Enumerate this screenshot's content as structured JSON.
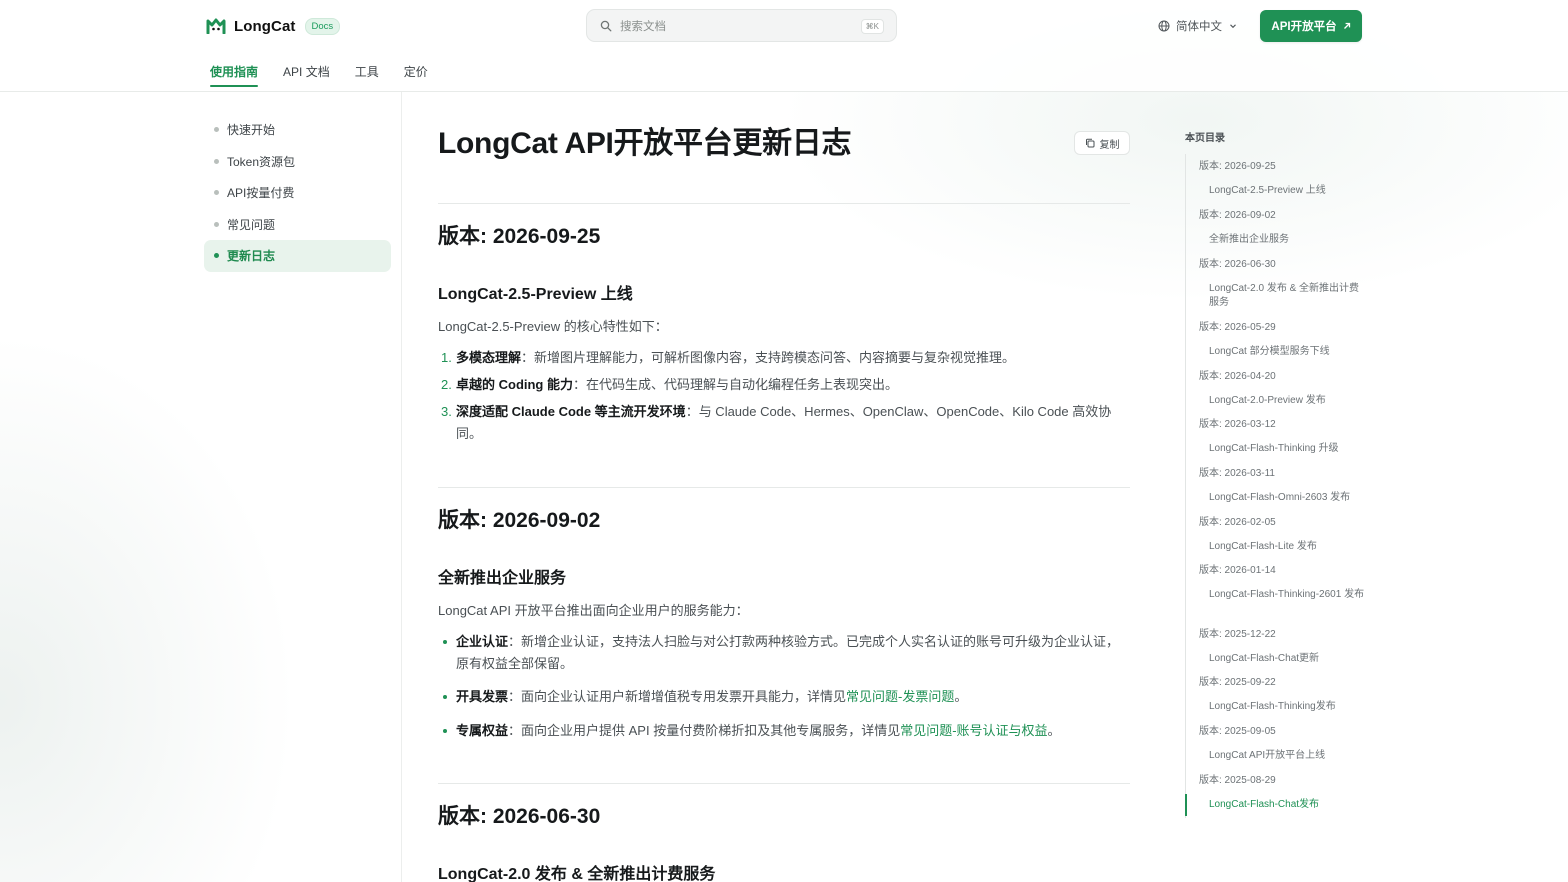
{
  "header": {
    "logo_text": "LongCat",
    "docs_badge": "Docs",
    "search_placeholder": "搜索文档",
    "search_shortcut": "⌘K",
    "language": "简体中文",
    "cta_label": "API开放平台",
    "tabs": [
      {
        "label": "使用指南",
        "active": true
      },
      {
        "label": "API 文档",
        "active": false
      },
      {
        "label": "工具",
        "active": false
      },
      {
        "label": "定价",
        "active": false
      }
    ]
  },
  "sidebar": {
    "items": [
      {
        "label": "快速开始",
        "active": false
      },
      {
        "label": "Token资源包",
        "active": false
      },
      {
        "label": "API按量付费",
        "active": false
      },
      {
        "label": "常见问题",
        "active": false
      },
      {
        "label": "更新日志",
        "active": true
      }
    ]
  },
  "main": {
    "title": "LongCat API开放平台更新日志",
    "copy_label": "复制",
    "v1": {
      "heading": "版本: 2026-09-25",
      "subheading": "LongCat-2.5-Preview 上线",
      "intro": "LongCat-2.5-Preview 的核心特性如下：",
      "items": [
        {
          "num": "1.",
          "bold": "多模态理解",
          "text": "：新增图片理解能力，可解析图像内容，支持跨模态问答、内容摘要与复杂视觉推理。"
        },
        {
          "num": "2.",
          "bold": "卓越的 Coding 能力",
          "text": "：在代码生成、代码理解与自动化编程任务上表现突出。"
        },
        {
          "num": "3.",
          "bold": "深度适配 Claude Code 等主流开发环境",
          "text": "：与 Claude Code、Hermes、OpenClaw、OpenCode、Kilo Code 高效协同。"
        }
      ]
    },
    "v2": {
      "heading": "版本: 2026-09-02",
      "subheading": "全新推出企业服务",
      "intro": "LongCat API 开放平台推出面向企业用户的服务能力：",
      "items": [
        {
          "bold": "企业认证",
          "text": "：新增企业认证，支持法人扫脸与对公打款两种核验方式。已完成个人实名认证的账号可升级为企业认证，原有权益全部保留。",
          "link": "",
          "tail": ""
        },
        {
          "bold": "开具发票",
          "text": "：面向企业认证用户新增增值税专用发票开具能力，详情见",
          "link": "常见问题-发票问题",
          "tail": "。"
        },
        {
          "bold": "专属权益",
          "text": "：面向企业用户提供 API 按量付费阶梯折扣及其他专属服务，详情见",
          "link": "常见问题-账号认证与权益",
          "tail": "。"
        }
      ]
    },
    "v3": {
      "heading": "版本: 2026-06-30",
      "subheading": "LongCat-2.0 发布 & 全新推出计费服务"
    }
  },
  "toc": {
    "title": "本页目录",
    "items": [
      {
        "label": "版本: 2026-09-25",
        "sub": false
      },
      {
        "label": "LongCat-2.5-Preview 上线",
        "sub": true
      },
      {
        "label": "版本: 2026-09-02",
        "sub": false
      },
      {
        "label": "全新推出企业服务",
        "sub": true
      },
      {
        "label": "版本: 2026-06-30",
        "sub": false
      },
      {
        "label": "LongCat-2.0 发布 & 全新推出计费服务",
        "sub": true
      },
      {
        "label": "版本: 2026-05-29",
        "sub": false
      },
      {
        "label": "LongCat 部分模型服务下线",
        "sub": true
      },
      {
        "label": "版本: 2026-04-20",
        "sub": false
      },
      {
        "label": "LongCat-2.0-Preview 发布",
        "sub": true
      },
      {
        "label": "版本: 2026-03-12",
        "sub": false
      },
      {
        "label": "LongCat-Flash-Thinking 升级",
        "sub": true
      },
      {
        "label": "版本: 2026-03-11",
        "sub": false
      },
      {
        "label": "LongCat-Flash-Omni-2603 发布",
        "sub": true
      },
      {
        "label": "版本: 2026-02-05",
        "sub": false
      },
      {
        "label": "LongCat-Flash-Lite 发布",
        "sub": true
      },
      {
        "label": "版本: 2026-01-14",
        "sub": false
      },
      {
        "label": "LongCat-Flash-Thinking-2601 发布",
        "sub": true
      },
      {
        "label": "版本: 2025-12-22",
        "sub": false
      },
      {
        "label": "LongCat-Flash-Chat更新",
        "sub": true
      },
      {
        "label": "版本: 2025-09-22",
        "sub": false
      },
      {
        "label": "LongCat-Flash-Thinking发布",
        "sub": true
      },
      {
        "label": "版本: 2025-09-05",
        "sub": false
      },
      {
        "label": "LongCat API开放平台上线",
        "sub": true
      },
      {
        "label": "版本: 2025-08-29",
        "sub": false
      },
      {
        "label": "LongCat-Flash-Chat发布",
        "sub": true,
        "active": true
      }
    ]
  },
  "colors": {
    "accent": "#1f9155",
    "accent_bg": "#e8f3ec",
    "text": "#16191b",
    "muted": "#4a5054"
  }
}
